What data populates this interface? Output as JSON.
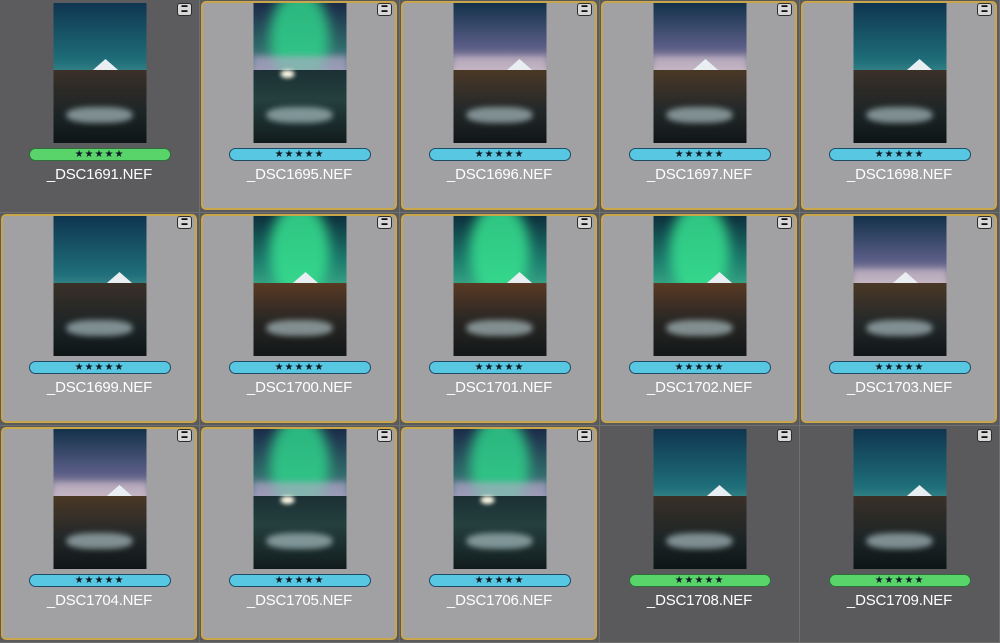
{
  "grid": {
    "cells": [
      {
        "filename": "_DSC1691.NEF",
        "rating": "★★★★★",
        "label_color": "green",
        "selected": false,
        "thumb": "peak-river"
      },
      {
        "filename": "_DSC1695.NEF",
        "rating": "★★★★★",
        "label_color": "blue",
        "selected": true,
        "thumb": "aurora-lake"
      },
      {
        "filename": "_DSC1696.NEF",
        "rating": "★★★★★",
        "label_color": "blue",
        "selected": true,
        "thumb": "cloud-river"
      },
      {
        "filename": "_DSC1697.NEF",
        "rating": "★★★★★",
        "label_color": "blue",
        "selected": true,
        "thumb": "cloud-river"
      },
      {
        "filename": "_DSC1698.NEF",
        "rating": "★★★★★",
        "label_color": "blue",
        "selected": true,
        "thumb": "peak-river"
      },
      {
        "filename": "_DSC1699.NEF",
        "rating": "★★★★★",
        "label_color": "blue",
        "selected": true,
        "thumb": "peak-river"
      },
      {
        "filename": "_DSC1700.NEF",
        "rating": "★★★★★",
        "label_color": "blue",
        "selected": true,
        "thumb": "aurora-rocks"
      },
      {
        "filename": "_DSC1701.NEF",
        "rating": "★★★★★",
        "label_color": "blue",
        "selected": true,
        "thumb": "aurora-rocks"
      },
      {
        "filename": "_DSC1702.NEF",
        "rating": "★★★★★",
        "label_color": "blue",
        "selected": true,
        "thumb": "aurora-rocks"
      },
      {
        "filename": "_DSC1703.NEF",
        "rating": "★★★★★",
        "label_color": "blue",
        "selected": true,
        "thumb": "cloud-river"
      },
      {
        "filename": "_DSC1704.NEF",
        "rating": "★★★★★",
        "label_color": "blue",
        "selected": true,
        "thumb": "cloud-river"
      },
      {
        "filename": "_DSC1705.NEF",
        "rating": "★★★★★",
        "label_color": "blue",
        "selected": true,
        "thumb": "aurora-lake"
      },
      {
        "filename": "_DSC1706.NEF",
        "rating": "★★★★★",
        "label_color": "blue",
        "selected": true,
        "thumb": "aurora-lake"
      },
      {
        "filename": "_DSC1708.NEF",
        "rating": "★★★★★",
        "label_color": "green",
        "selected": false,
        "thumb": "peak-river"
      },
      {
        "filename": "_DSC1709.NEF",
        "rating": "★★★★★",
        "label_color": "green",
        "selected": false,
        "thumb": "peak-river"
      }
    ],
    "badge_icon": "stack-badge-icon",
    "colors": {
      "selection_border": "#c9a64a",
      "label_blue": "#57c7e2",
      "label_green": "#58d46a"
    }
  }
}
